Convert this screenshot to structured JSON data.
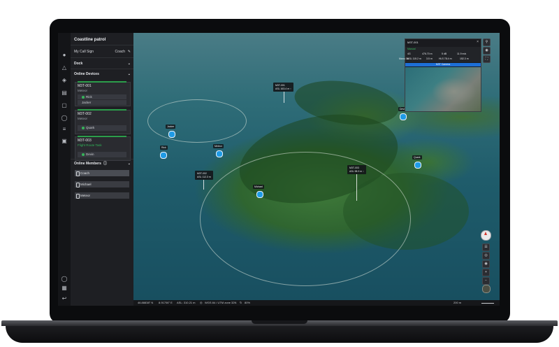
{
  "sidebar": {
    "title": "Coastline patrol",
    "call_sign_label": "My Call Sign",
    "call_sign_value": "Coach",
    "dock_label": "Dock",
    "online_devices_label": "Online Devices",
    "devices": [
      {
        "name": "M3T-001",
        "status": "Meteor",
        "pilot": "Rick",
        "operator": "Jacker"
      },
      {
        "name": "M3T-002",
        "status": "Meteor",
        "pilot": "Quark",
        "operator": ""
      },
      {
        "name": "M3T-003",
        "status": "Flight Route Task",
        "pilot": "Devin",
        "operator": ""
      }
    ],
    "online_members_label": "Online Members",
    "members": [
      "Coach",
      "Michael",
      "Meteor"
    ]
  },
  "map": {
    "markers": [
      {
        "label": "Jacker"
      },
      {
        "label": "Rick"
      },
      {
        "label": "Meteor"
      },
      {
        "label": "Michael"
      },
      {
        "label": "Quark"
      },
      {
        "label": "Devin"
      }
    ],
    "drones": [
      {
        "name": "M3T-001",
        "detail": "ASL 163.4 m ↑"
      },
      {
        "name": "M3T-002",
        "detail": "ASL 112.3 m"
      },
      {
        "name": "M3T-003",
        "detail": "ASL 98.9 m ↑"
      }
    ]
  },
  "video_panel": {
    "title": "M3T-001",
    "status": "Manual",
    "telemetry": [
      "4G",
      "476.70 m",
      "5 dB",
      "11.9 m/s",
      "ASL 115.2 m",
      "3.5 m",
      "HLS 78.4 m",
      "152.3 m"
    ],
    "camera_label": "M3T Camera",
    "side_label": "Manu 36"
  },
  "status_bar": {
    "lat": "46.88838° N",
    "lon": "8.91706° E",
    "asl": "ASL: 310.21 m",
    "crs": "WGS 84 / UTM zone 32N",
    "battery": "80%",
    "scale": "200 m"
  }
}
